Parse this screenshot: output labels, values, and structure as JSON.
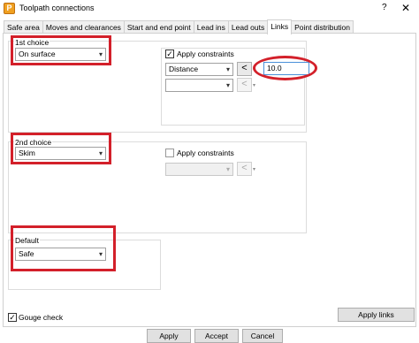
{
  "window": {
    "title": "Toolpath connections",
    "help": "?",
    "close": "✕",
    "icon_letter": "P"
  },
  "tabs": [
    {
      "label": "Safe area",
      "active": false
    },
    {
      "label": "Moves and clearances",
      "active": false
    },
    {
      "label": "Start and end point",
      "active": false
    },
    {
      "label": "Lead ins",
      "active": false
    },
    {
      "label": "Lead outs",
      "active": false
    },
    {
      "label": "Links",
      "active": true
    },
    {
      "label": "Point distribution",
      "active": false
    }
  ],
  "first_choice": {
    "label": "1st choice",
    "value": "On surface",
    "apply_constraints": {
      "label": "Apply constraints",
      "checked": true
    },
    "constraint1": {
      "value": "Distance",
      "operator": "<",
      "amount": "10.0"
    },
    "constraint2": {
      "value": "",
      "operator": "<"
    }
  },
  "second_choice": {
    "label": "2nd choice",
    "value": "Skim",
    "apply_constraints": {
      "label": "Apply constraints",
      "checked": false
    },
    "constraint1": {
      "value": "",
      "operator": "<"
    }
  },
  "default": {
    "label": "Default",
    "value": "Safe"
  },
  "gouge_check": {
    "label": "Gouge check",
    "checked": true
  },
  "buttons": {
    "apply_links": "Apply links",
    "apply": "Apply",
    "accept": "Accept",
    "cancel": "Cancel"
  },
  "icons": {
    "dropdown": "▾",
    "check": "✓"
  },
  "colors": {
    "highlight": "#d3202a",
    "input_focus": "#4a90d9"
  }
}
